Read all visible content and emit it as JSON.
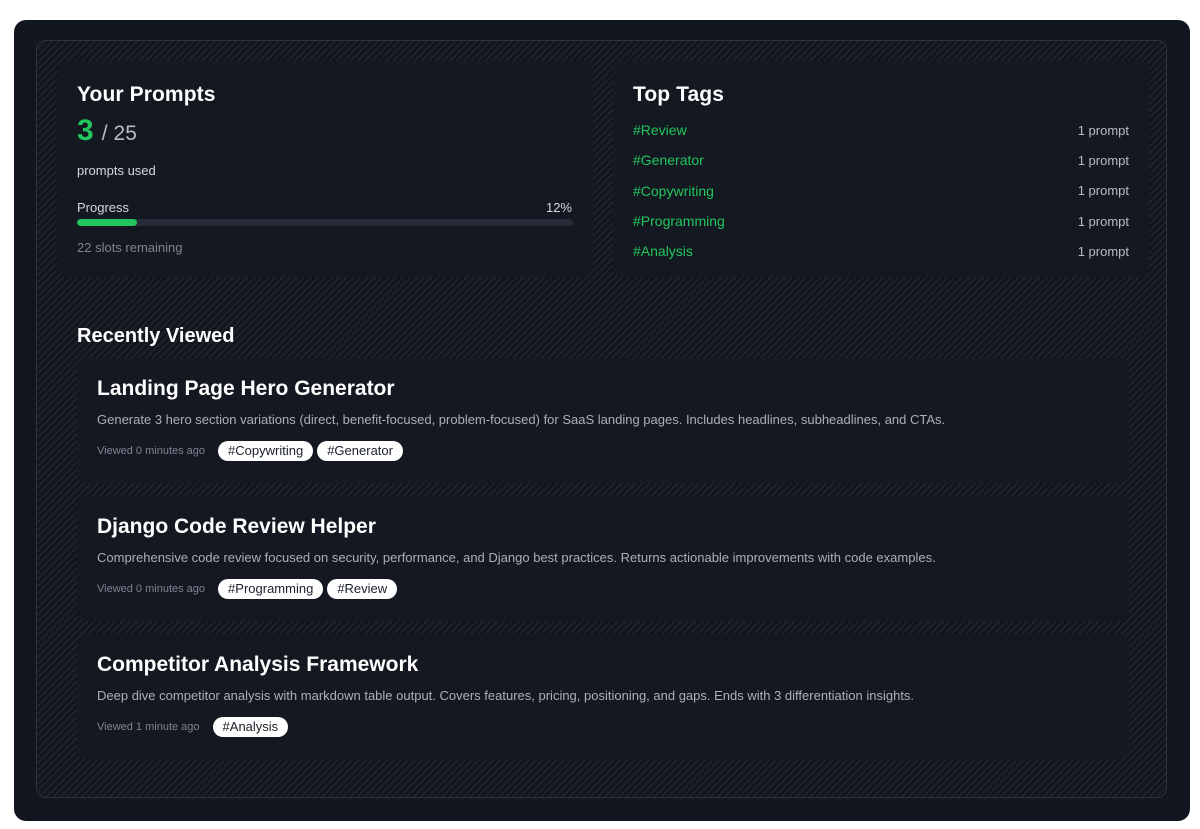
{
  "prompts_card": {
    "title": "Your Prompts",
    "used": "3",
    "slash": "/",
    "total": "25",
    "used_label": "prompts used",
    "progress_label": "Progress",
    "progress_percent": "12%",
    "progress_fraction": 0.12,
    "remaining": "22 slots remaining"
  },
  "tags_card": {
    "title": "Top Tags",
    "items": [
      {
        "name": "#Review",
        "count": "1 prompt"
      },
      {
        "name": "#Generator",
        "count": "1 prompt"
      },
      {
        "name": "#Copywriting",
        "count": "1 prompt"
      },
      {
        "name": "#Programming",
        "count": "1 prompt"
      },
      {
        "name": "#Analysis",
        "count": "1 prompt"
      }
    ]
  },
  "recent": {
    "title": "Recently Viewed",
    "items": [
      {
        "title": "Landing Page Hero Generator",
        "description": "Generate 3 hero section variations (direct, benefit-focused, problem-focused) for SaaS landing pages. Includes headlines, subheadlines, and CTAs.",
        "viewed": "Viewed 0 minutes ago",
        "tags": [
          "#Copywriting",
          "#Generator"
        ]
      },
      {
        "title": "Django Code Review Helper",
        "description": "Comprehensive code review focused on security, performance, and Django best practices. Returns actionable improvements with code examples.",
        "viewed": "Viewed 0 minutes ago",
        "tags": [
          "#Programming",
          "#Review"
        ]
      },
      {
        "title": "Competitor Analysis Framework",
        "description": "Deep dive competitor analysis with markdown table output. Covers features, pricing, positioning, and gaps. Ends with 3 differentiation insights.",
        "viewed": "Viewed 1 minute ago",
        "tags": [
          "#Analysis"
        ]
      }
    ]
  },
  "colors": {
    "accent": "#22c55e",
    "background": "#111620",
    "card": "#131821",
    "chip": "#ffffff"
  }
}
